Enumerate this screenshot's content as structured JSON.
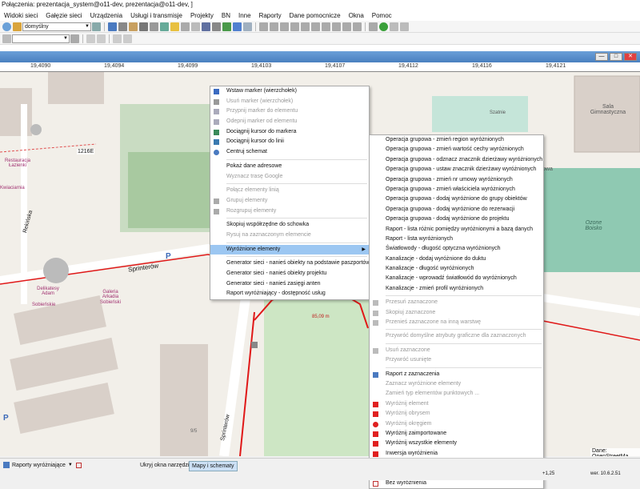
{
  "window": {
    "title": "Połączenia: prezentacja_system@o11-dev, prezentacja@o11-dev, ]"
  },
  "menubar": [
    {
      "label": "Widoki sieci"
    },
    {
      "label": "Gałęzie sieci"
    },
    {
      "label": "Urządzenia"
    },
    {
      "label": "Usługi i transmisje"
    },
    {
      "label": "Projekty"
    },
    {
      "label": "BN"
    },
    {
      "label": "Inne"
    },
    {
      "label": "Raporty"
    },
    {
      "label": "Dane pomocnicze"
    },
    {
      "label": "Okna"
    },
    {
      "label": "Pomoc"
    }
  ],
  "toolbar": {
    "style_combo": "domyślny"
  },
  "ruler": {
    "ticks": [
      "19,4090",
      "19,4094",
      "19,4099",
      "19,4103",
      "19,4107",
      "19,4112",
      "19,4116",
      "19,4121"
    ]
  },
  "map": {
    "labels": {
      "street_1216e": "1216E",
      "street_rekinska": "Rekińska",
      "street_sprinterow": "Sprinterów",
      "street_sprinterow_vertical": "Sprinterów",
      "restaurant": "Restauracja Łazienki",
      "restaurant_prefix": "Res",
      "flower": "Kwiaciarnia",
      "shop1": "Delikatesy Adam",
      "shop2": "Sobieńskie",
      "shop3": "Galeria Arkadia",
      "shop4": "Sobieński",
      "school_hall": "Sala Gimnastyczna",
      "field": "Ozone Boisko",
      "trees_name": "Szatnie",
      "route_length": "85,09 m",
      "partial_label": "owa",
      "parking": "P",
      "parking2": "P",
      "building_num": "9/5",
      "attrib": "Dane: OpenStreetMa"
    }
  },
  "context_menu": {
    "items": [
      {
        "label": "Wstaw marker (wierzchołek)",
        "enabled": true,
        "icon": "pin-icon"
      },
      {
        "label": "Usuń marker (wierzchołek)",
        "enabled": false,
        "icon": "x-icon"
      },
      {
        "label": "Przypnij marker do elementu",
        "enabled": false,
        "icon": "pin-attach-icon"
      },
      {
        "label": "Odepnij marker od elementu",
        "enabled": false,
        "icon": "pin-detach-icon"
      },
      {
        "label": "Dociągnij kursor do markera",
        "enabled": true,
        "icon": "snap-marker-icon"
      },
      {
        "label": "Dociągnij kursor do linii",
        "enabled": true,
        "icon": "snap-line-icon"
      },
      {
        "label": "Centruj schemat",
        "enabled": true,
        "icon": "center-icon"
      },
      {
        "sep": true
      },
      {
        "label": "Pokaż dane adresowe",
        "enabled": true
      },
      {
        "label": "Wyznacz trasę Google",
        "enabled": false
      },
      {
        "sep": true
      },
      {
        "label": "Połącz elementy linią",
        "enabled": false
      },
      {
        "label": "Grupuj elementy",
        "enabled": false,
        "icon": "group-icon"
      },
      {
        "label": "Rozgrupuj elementy",
        "enabled": false,
        "icon": "ungroup-icon"
      },
      {
        "sep": true
      },
      {
        "label": "Skopiuj współrzędne do schowka",
        "enabled": true
      },
      {
        "label": "Rysuj na zaznaczonym elemencie",
        "enabled": false
      },
      {
        "sep": true
      },
      {
        "label": "Wyróżnione elementy",
        "enabled": true,
        "submenu": true,
        "highlighted": true
      },
      {
        "sep": true
      },
      {
        "label": "Generator sieci - nanieś obiekty na podstawie paszportów",
        "enabled": true
      },
      {
        "label": "Generator sieci - nanieś obiekty projektu",
        "enabled": true
      },
      {
        "label": "Generator sieci - nanieś zasięgi anten",
        "enabled": true
      },
      {
        "label": "Raport wyróżniający - dostępność usług",
        "enabled": true
      }
    ]
  },
  "submenu": {
    "items": [
      {
        "label": "Operacja grupowa - zmień region wyróżnionych",
        "enabled": true
      },
      {
        "label": "Operacja grupowa - zmień wartość cechy wyróżnionych",
        "enabled": true
      },
      {
        "label": "Operacja grupowa - odznacz znacznik dzierżawy wyróżnionych",
        "enabled": true
      },
      {
        "label": "Operacja grupowa - ustaw znacznik dzierżawy wyróżnionych",
        "enabled": true
      },
      {
        "label": "Operacja grupowa - zmień nr umowy wyróżnionych",
        "enabled": true
      },
      {
        "label": "Operacja grupowa - zmień właściciela wyróżnionych",
        "enabled": true
      },
      {
        "label": "Operacja grupowa - dodaj wyróżnione do grupy obiektów",
        "enabled": true
      },
      {
        "label": "Operacja grupowa - dodaj wyróżnione do rezerwacji",
        "enabled": true
      },
      {
        "label": "Operacja grupowa - dodaj wyróżnione do projektu",
        "enabled": true
      },
      {
        "label": "Raport - lista różnic pomiędzy wyróżnionymi a bazą danych",
        "enabled": true
      },
      {
        "label": "Raport - lista wyróżnionych",
        "enabled": true
      },
      {
        "label": "Światłowody - długość optyczna wyróżnionych",
        "enabled": true
      },
      {
        "label": "Kanalizacje - dodaj wyróżnione do duktu",
        "enabled": true
      },
      {
        "label": "Kanalizacje - długość wyróżnionych",
        "enabled": true
      },
      {
        "label": "Kanalizacje - wprowadź światłowód do wyróżnionych",
        "enabled": true
      },
      {
        "label": "Kanalizacje - zmień profil wyróżnionych",
        "enabled": true
      },
      {
        "sep": true
      },
      {
        "label": "Przesuń zaznaczone",
        "enabled": false,
        "icon": "move-icon"
      },
      {
        "label": "Skopiuj zaznaczone",
        "enabled": false,
        "icon": "copy-icon"
      },
      {
        "label": "Przenieś zaznaczone na inną warstwę",
        "enabled": false,
        "icon": "layer-icon"
      },
      {
        "sep": true
      },
      {
        "label": "Przywróć domyślne atrybuty graficzne dla zaznaczonych",
        "enabled": false
      },
      {
        "sep": true
      },
      {
        "label": "Usuń zaznaczone",
        "enabled": false,
        "icon": "delete-icon"
      },
      {
        "label": "Przywróć usunięte",
        "enabled": false
      },
      {
        "sep": true
      },
      {
        "label": "Raport z zaznaczenia",
        "enabled": true,
        "icon": "report-icon"
      },
      {
        "label": "Zaznacz wyróżnione elementy",
        "enabled": false
      },
      {
        "label": "Zamień typ elementów punktowych ...",
        "enabled": false
      },
      {
        "label": "Wyróżnij element",
        "enabled": false,
        "icon": "highlight-element-icon"
      },
      {
        "label": "Wyróżnij obrysem",
        "enabled": false,
        "icon": "highlight-outline-icon"
      },
      {
        "label": "Wyróżnij okręgiem",
        "enabled": false,
        "icon": "highlight-circle-icon"
      },
      {
        "label": "Wyróżnij zaimportowane",
        "enabled": true,
        "icon": "highlight-imported-icon"
      },
      {
        "label": "Wyróżnij wszystkie elementy",
        "enabled": true,
        "icon": "highlight-all-icon"
      },
      {
        "label": "Inwersja wyróżnienia",
        "enabled": true,
        "icon": "invert-icon"
      },
      {
        "label": "Zaznacz wybrane elementy",
        "enabled": true,
        "icon": "select-chosen-icon"
      },
      {
        "label": "Grupuj wyróżnione",
        "enabled": true,
        "icon": "group-highlighted-icon"
      },
      {
        "label": "Bez wyróżnienia",
        "enabled": true,
        "icon": "no-highlight-icon"
      }
    ]
  },
  "statusbar": {
    "report_button": "Raporty wyróżniające",
    "hide_tools": "Ukryj okna narzędzi",
    "maps_schemes": "Mapy i schematy",
    "coord": "+1,25",
    "version": "wer. 10.6.2.51"
  }
}
